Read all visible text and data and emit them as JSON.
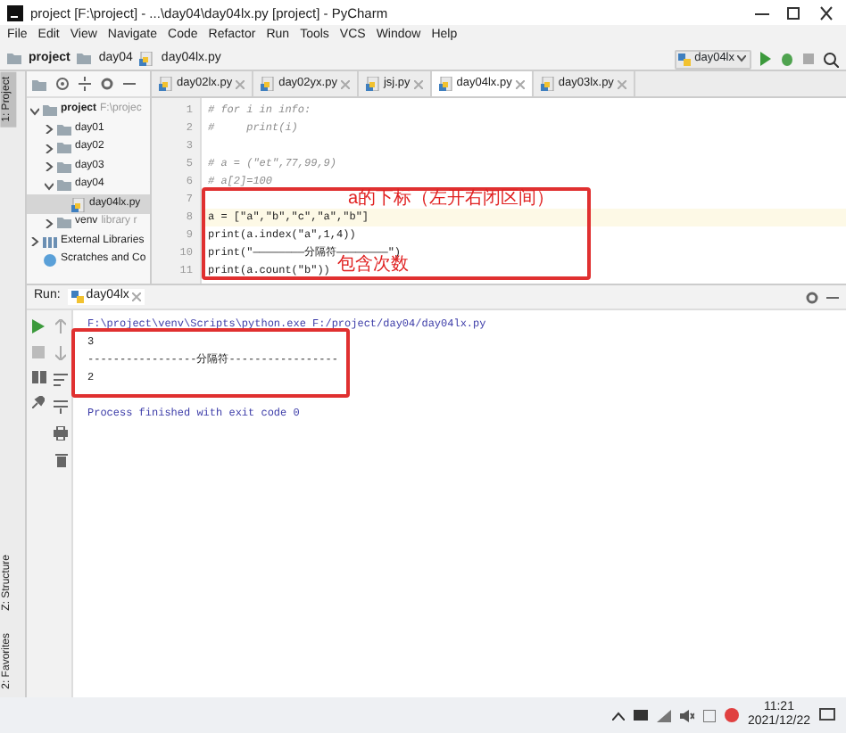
{
  "window": {
    "title": "project [F:\\project] - ...\\day04\\day04lx.py [project] - PyCharm"
  },
  "menu": [
    "File",
    "Edit",
    "View",
    "Navigate",
    "Code",
    "Refactor",
    "Run",
    "Tools",
    "VCS",
    "Window",
    "Help"
  ],
  "breadcrumb": [
    "project",
    "day04",
    "day04lx.py"
  ],
  "run_config": "day04lx",
  "side_tabs": [
    {
      "label": "1: Project",
      "selected": true
    },
    {
      "label": "Z: Structure",
      "selected": false
    },
    {
      "label": "2: Favorites",
      "selected": false
    }
  ],
  "tree": [
    {
      "label": "project",
      "note": "F:\\projec",
      "kind": "folder",
      "expanded": true,
      "selected": false,
      "children": [
        {
          "label": "day01",
          "kind": "folder",
          "expanded": false,
          "selected": false
        },
        {
          "label": "day02",
          "kind": "folder",
          "expanded": false,
          "selected": false
        },
        {
          "label": "day03",
          "kind": "folder",
          "expanded": false,
          "selected": false
        },
        {
          "label": "day04",
          "kind": "folder",
          "expanded": true,
          "selected": false,
          "children": [
            {
              "label": "day04lx.py",
              "kind": "file",
              "selected": true
            }
          ]
        },
        {
          "label": "venv",
          "note": "library r",
          "kind": "folder",
          "expanded": false,
          "selected": false
        }
      ]
    },
    {
      "label": "External Libraries",
      "kind": "library",
      "expanded": false,
      "selected": false
    },
    {
      "label": "Scratches and Co",
      "kind": "scratch",
      "selected": false
    }
  ],
  "tabs": [
    {
      "label": "day02lx.py",
      "selected": false
    },
    {
      "label": "day02yx.py",
      "selected": false
    },
    {
      "label": "jsj.py",
      "selected": false
    },
    {
      "label": "day04lx.py",
      "selected": true
    },
    {
      "label": "day03lx.py",
      "selected": false
    }
  ],
  "lines": [
    {
      "number": "1",
      "code": "# for i in info:",
      "kind": "comment",
      "highlighted": false
    },
    {
      "number": "2",
      "code": "#     print(i)",
      "kind": "comment",
      "highlighted": false
    },
    {
      "number": "3",
      "highlighted": false
    },
    {
      "number": "5",
      "code": "# a = (\"et\",77,99,9)",
      "kind": "comment",
      "highlighted": false
    },
    {
      "number": "6",
      "code": "# a[2]=100",
      "kind": "comment",
      "highlighted": false
    },
    {
      "number": "7",
      "highlighted": false
    },
    {
      "number": "8",
      "code": "a = [\"a\",\"b\",\"c\",\"a\",\"b\"]",
      "kind": "code",
      "highlighted": true
    },
    {
      "number": "9",
      "code": "print(a.index(\"a\",1,4))",
      "kind": "code",
      "highlighted": false
    },
    {
      "number": "10",
      "code": "print(\"————————分隔符————————\")",
      "kind": "code",
      "highlighted": false
    },
    {
      "number": "11",
      "code": "print(a.count(\"b\"))",
      "kind": "code",
      "highlighted": false
    }
  ],
  "annotations": [
    "a的下标（左开右闭区间）",
    "包含次数"
  ],
  "run": {
    "label": "Run:",
    "tab": "day04lx",
    "output": [
      {
        "text": "F:\\project\\venv\\Scripts\\python.exe F:/project/day04/day04lx.py",
        "kind": "command"
      },
      {
        "text": "3",
        "kind": "stdout"
      },
      {
        "text": "-----------------分隔符-----------------",
        "kind": "stdout"
      },
      {
        "text": "2",
        "kind": "stdout"
      },
      {
        "kind": "blank"
      },
      {
        "text": "Process finished with exit code 0",
        "kind": "status"
      }
    ]
  },
  "taskbar": {
    "time": "11:21",
    "date": "2021/12/22"
  }
}
